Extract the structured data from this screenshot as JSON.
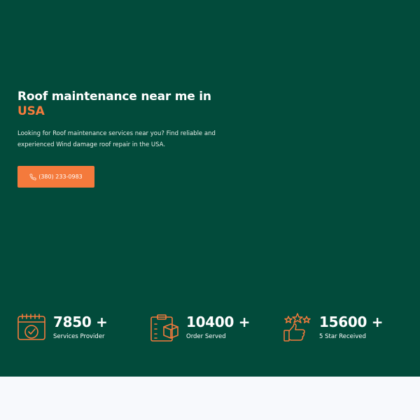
{
  "hero": {
    "title_line1": "Roof maintenance near me in",
    "title_accent": "USA",
    "description": "Looking for Roof maintenance services near you? Find reliable and experienced Wind damage roof repair in the USA.",
    "cta": {
      "icon": "phone-icon",
      "label": "(380) 233-0983"
    }
  },
  "stats": [
    {
      "icon": "calendar-check-icon",
      "value": "7850 +",
      "label": "Services Provider"
    },
    {
      "icon": "clipboard-box-icon",
      "value": "10400 +",
      "label": "Order Served"
    },
    {
      "icon": "thumbs-up-stars-icon",
      "value": "15600 +",
      "label": "5 Star Received"
    }
  ],
  "colors": {
    "hero_bg": "#024b3b",
    "accent": "#f37b3c",
    "text": "#ffffff",
    "page_bg": "#f7f9fc"
  }
}
